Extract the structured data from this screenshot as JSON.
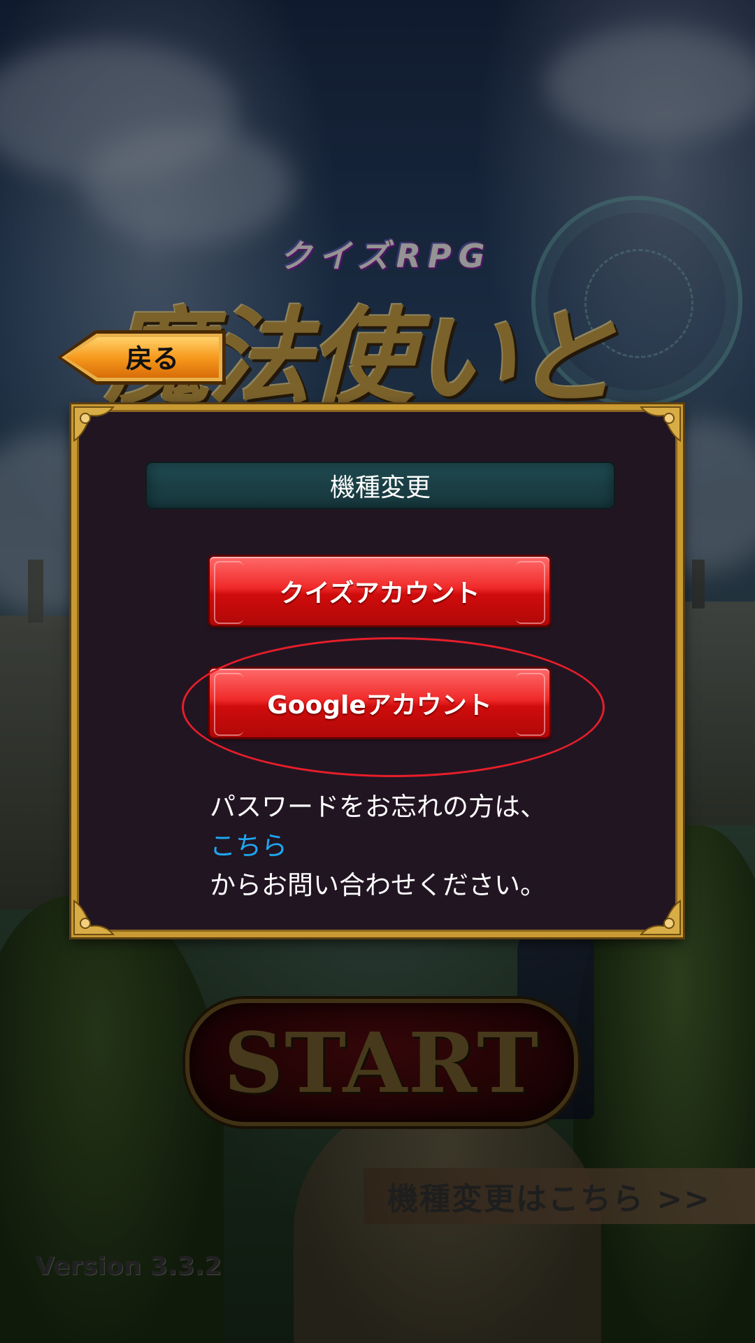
{
  "background": {
    "logo_subtitle": "クイズRPG",
    "logo_title": "魔法使いと",
    "start_button_label": "START",
    "model_change_link": "機種変更はこちら >>",
    "version": "Version 3.3.2"
  },
  "back_button": {
    "label": "戻る"
  },
  "dialog": {
    "title": "機種変更",
    "quiz_account_button": "クイズアカウント",
    "google_account_button": "Googleアカウント",
    "help_line1": "パスワードをお忘れの方は、",
    "help_link": "こちら",
    "help_line3": "からお問い合わせください。"
  },
  "colors": {
    "frame_gold": "#c99a32",
    "dialog_bg": "#221522",
    "title_bar": "#1a3e44",
    "button_red": "#e81818",
    "link_blue": "#1da7f0",
    "highlight_red": "#e61e2a"
  }
}
